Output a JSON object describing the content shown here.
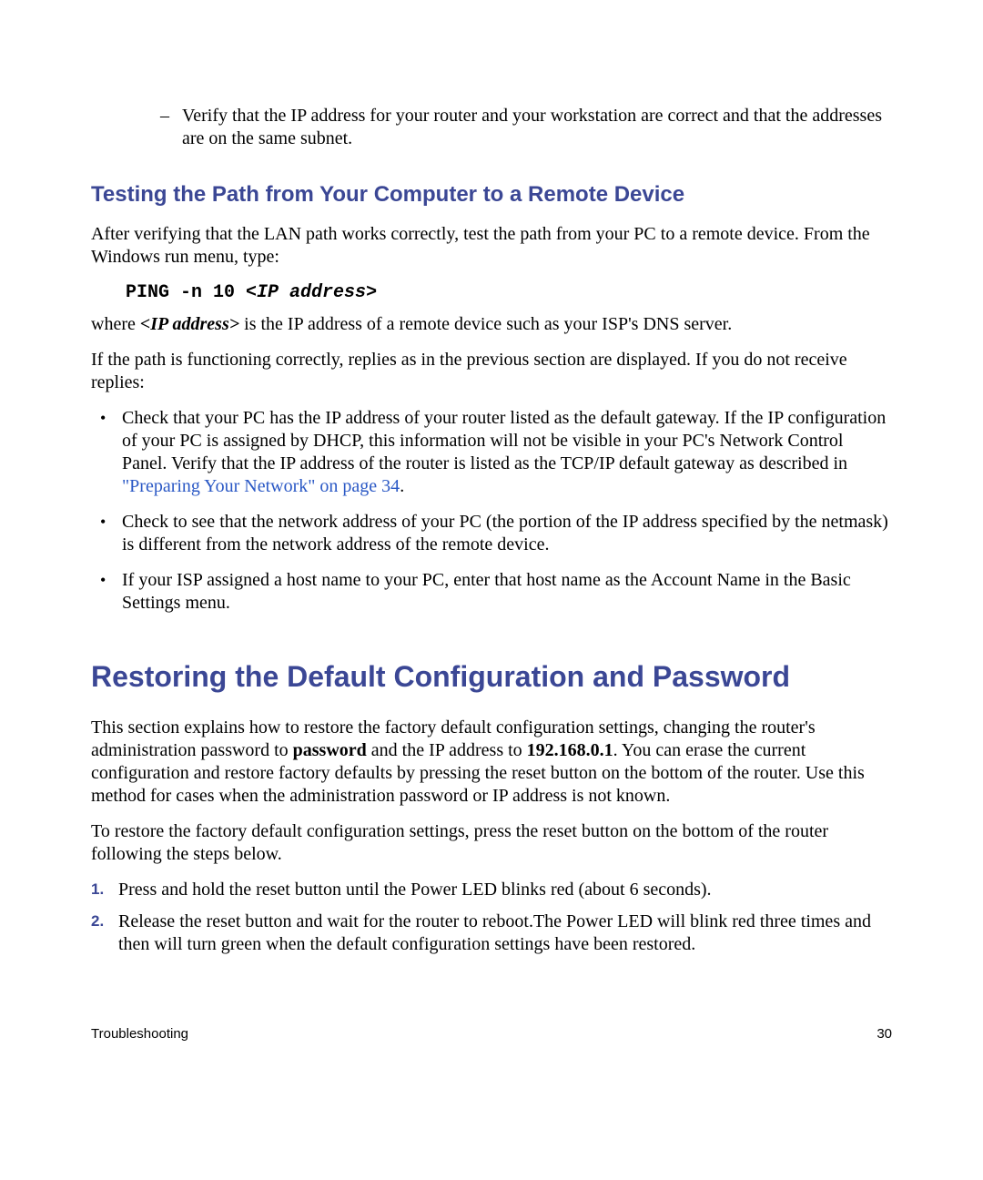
{
  "sub_bullet": {
    "dash": "–",
    "text": "Verify that the IP address for your router and your workstation are correct and that the addresses are on the same subnet."
  },
  "h2_testing": "Testing the Path from Your Computer to a Remote Device",
  "p_after_verify": "After verifying that the LAN path works correctly, test the path from your PC to a remote device. From the Windows run menu, type:",
  "mono": {
    "prefix": "PING -n 10 <",
    "italic": "IP address",
    "suffix": ">"
  },
  "p_where_pre": "where ",
  "p_where_ital": "<IP address>",
  "p_where_post": " is the IP address of a remote device such as your ISP's DNS server.",
  "p_if_path": "If the path is functioning correctly, replies as in the previous section are displayed. If you do not receive replies:",
  "bullets": {
    "b1_pre": "Check that your PC has the IP address of your router listed as the default gateway. If the IP configuration of your PC is assigned by DHCP, this information will not be visible in your PC's Network Control Panel. Verify that the IP address of the router is listed as the TCP/IP default gateway as described in ",
    "b1_link": "\"Preparing Your Network\" on page 34",
    "b1_post": ".",
    "b2": "Check to see that the network address of your PC (the portion of the IP address specified by the netmask) is different from the network address of the remote device.",
    "b3": "If your ISP assigned a host name to your PC, enter that host name as the Account Name in the Basic Settings menu."
  },
  "bullet_mark": "•",
  "h1_restoring": "Restoring the Default Configuration and Password",
  "p_restore_1a": "This section explains how to restore the factory default configuration settings, changing the router's administration password to ",
  "p_restore_1b_bold": "password",
  "p_restore_1c": " and the IP address to ",
  "p_restore_1d_bold": "192.168.0.1",
  "p_restore_1e": ". You can erase the current configuration and restore factory defaults by pressing the reset button on the bottom of the router. Use this method for cases when the administration password or IP address is not known.",
  "p_restore_2": "To restore the factory default configuration settings, press the reset button on the bottom of the router following the steps below.",
  "steps": {
    "n1": "1.",
    "t1": "Press and hold the reset button until the Power LED blinks red (about 6 seconds).",
    "n2": "2.",
    "t2": "Release the reset button and wait for the router to reboot.The Power LED will blink red three times and then will turn green when the default configuration settings have been restored."
  },
  "footer": {
    "section": "Troubleshooting",
    "page": "30"
  }
}
